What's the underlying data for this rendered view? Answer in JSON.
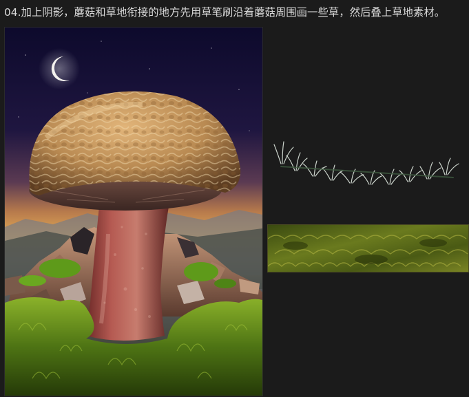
{
  "caption": "04.加上阴影，蘑菇和草地衔接的地方先用草笔刷沿着蘑菇周围画一些草，然后叠上草地素材。",
  "artwork": {
    "name": "mushroom-scene"
  },
  "brush_sample": {
    "name": "grass-brush-stroke"
  },
  "texture_sample": {
    "name": "grass-texture-material"
  },
  "colors": {
    "page_bg": "#1b1b1b",
    "caption_text": "#d8d8d8",
    "sky_top": "#0d0a2c",
    "sky_horizon": "#e0a24a",
    "cap_brown": "#c3935a",
    "stem_red": "#a44a45",
    "moss_green": "#6b8f1f"
  }
}
